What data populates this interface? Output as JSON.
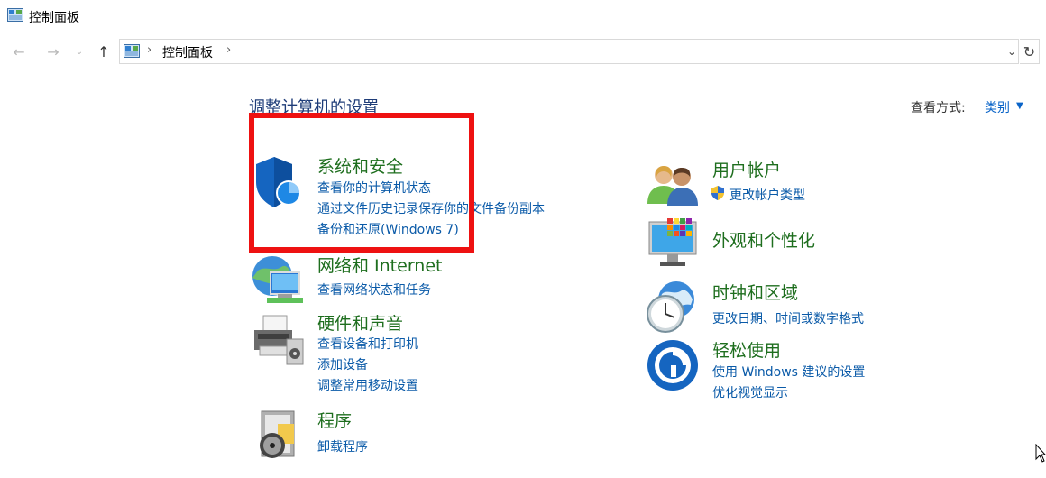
{
  "window": {
    "title": "控制面板"
  },
  "navigation": {
    "back_icon": "arrow-left-icon",
    "forward_icon": "arrow-right-icon",
    "up_icon": "arrow-up-icon",
    "breadcrumb": "控制面板",
    "refresh_icon": "refresh-icon"
  },
  "main": {
    "heading": "调整计算机的设置",
    "view_mode_label": "查看方式:",
    "view_mode_value": "类别"
  },
  "categories": {
    "system_security": {
      "title": "系统和安全",
      "links": [
        "查看你的计算机状态",
        "通过文件历史记录保存你的文件备份副本",
        "备份和还原(Windows 7)"
      ]
    },
    "network": {
      "title": "网络和 Internet",
      "links": [
        "查看网络状态和任务"
      ]
    },
    "hardware": {
      "title": "硬件和声音",
      "links": [
        "查看设备和打印机",
        "添加设备",
        "调整常用移动设置"
      ]
    },
    "programs": {
      "title": "程序",
      "links": [
        "卸载程序"
      ]
    },
    "user_accounts": {
      "title": "用户帐户",
      "links": [
        "更改帐户类型"
      ]
    },
    "appearance": {
      "title": "外观和个性化",
      "links": []
    },
    "clock_region": {
      "title": "时钟和区域",
      "links": [
        "更改日期、时间或数字格式"
      ]
    },
    "ease_of_access": {
      "title": "轻松使用",
      "links": [
        "使用 Windows 建议的设置",
        "优化视觉显示"
      ]
    }
  },
  "colors": {
    "category_title": "#1e6e1e",
    "link": "#0a5aa8",
    "heading": "#1e3c78",
    "highlight": "#ee1111"
  }
}
